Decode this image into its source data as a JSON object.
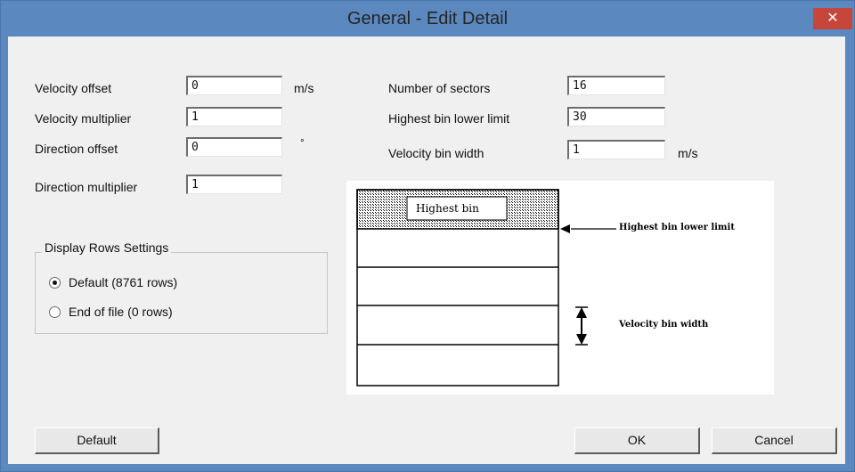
{
  "window": {
    "title": "General - Edit Detail",
    "close_glyph": "✕"
  },
  "fields": {
    "velocity_offset": {
      "label": "Velocity offset",
      "value": "0",
      "unit": "m/s"
    },
    "velocity_multiplier": {
      "label": "Velocity multiplier",
      "value": "1"
    },
    "direction_offset": {
      "label": "Direction offset",
      "value": "0",
      "unit": "°"
    },
    "direction_multiplier": {
      "label": "Direction multiplier",
      "value": "1"
    },
    "number_of_sectors": {
      "label": "Number of sectors",
      "value": "16"
    },
    "highest_bin_lower_limit": {
      "label": "Highest bin lower limit",
      "value": "30"
    },
    "velocity_bin_width": {
      "label": "Velocity bin width",
      "value": "1",
      "unit": "m/s"
    }
  },
  "display_rows": {
    "title": "Display Rows Settings",
    "options": [
      {
        "label": "Default (8761 rows)",
        "selected": true
      },
      {
        "label": "End of file (0 rows)",
        "selected": false
      }
    ]
  },
  "diagram": {
    "highest_bin": "Highest bin",
    "highest_bin_lower_limit": "Highest bin lower limit",
    "velocity_bin_width": "Velocity bin width"
  },
  "buttons": {
    "default": "Default",
    "ok": "OK",
    "cancel": "Cancel"
  },
  "colors": {
    "titlebar": "#5b88be",
    "close": "#c7463c",
    "client": "#f0f0f0"
  }
}
